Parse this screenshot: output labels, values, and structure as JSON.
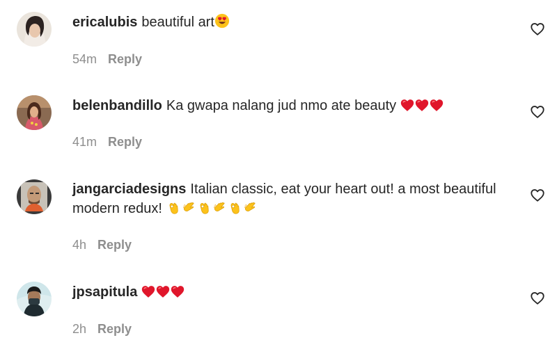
{
  "comments": [
    {
      "username": "ericalubis",
      "text": "beautiful art",
      "emojis": [
        "heart-eyes"
      ],
      "time": "54m",
      "reply_label": "Reply"
    },
    {
      "username": "belenbandillo",
      "text": "Ka gwapa nalang jud nmo ate beauty",
      "emojis": [
        "red-heart",
        "red-heart",
        "red-heart"
      ],
      "time": "41m",
      "reply_label": "Reply"
    },
    {
      "username": "jangarciadesigns",
      "text": "Italian classic, eat your heart out! a most beautiful modern redux!",
      "emojis": [
        "ok-hand",
        "clapping-hands",
        "ok-hand",
        "clapping-hands",
        "ok-hand",
        "clapping-hands"
      ],
      "time": "4h",
      "reply_label": "Reply"
    },
    {
      "username": "jpsapitula",
      "text": "",
      "emojis": [
        "red-heart",
        "red-heart",
        "red-heart"
      ],
      "time": "2h",
      "reply_label": "Reply"
    }
  ],
  "icons": {
    "like": "heart-outline-icon"
  },
  "colors": {
    "text": "#262626",
    "meta": "#8e8e8e",
    "emoji_heart": "#e0162b"
  }
}
